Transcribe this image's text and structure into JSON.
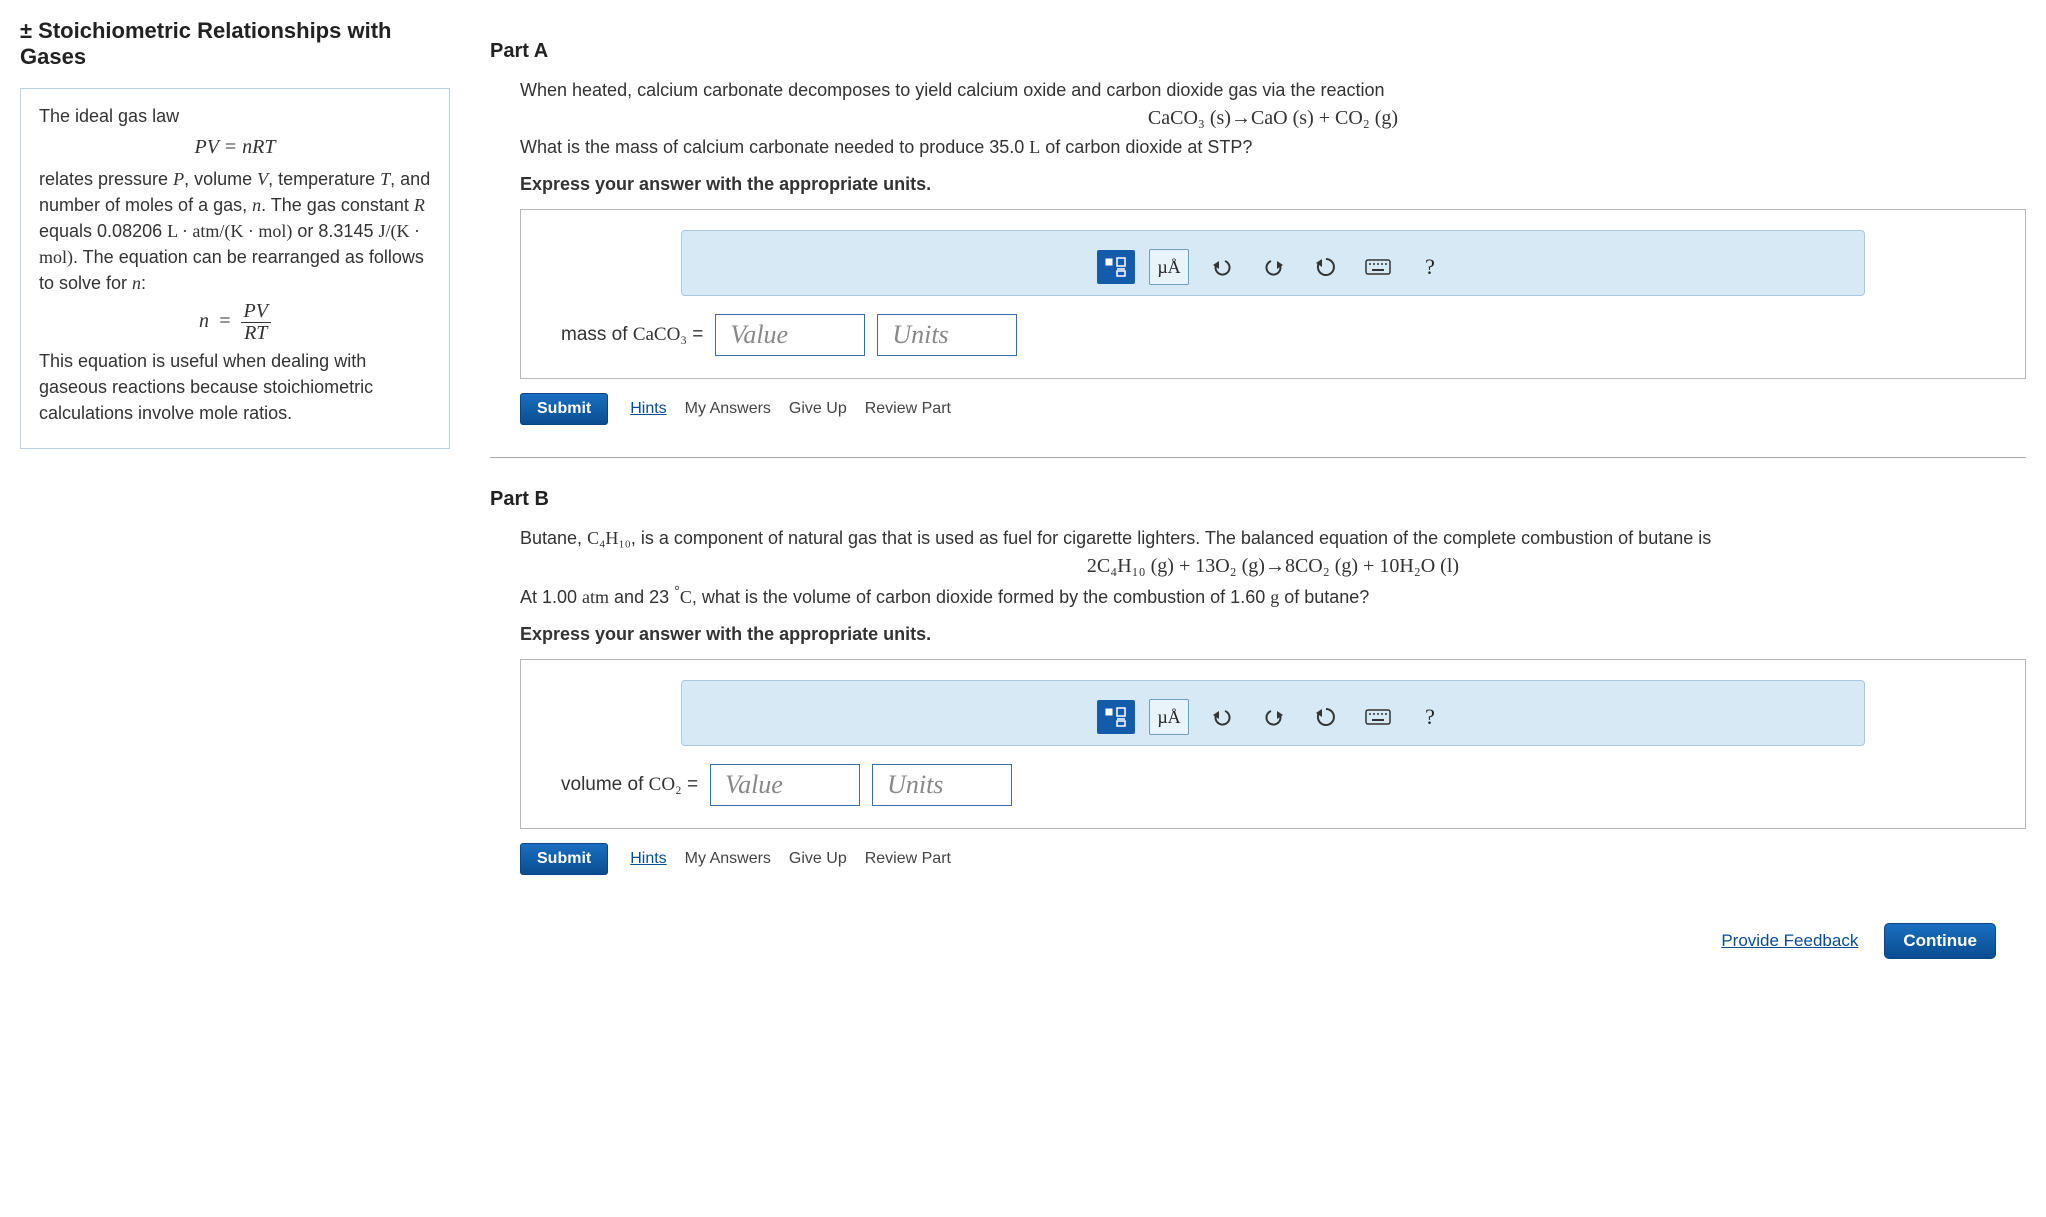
{
  "topic": {
    "title": "± Stoichiometric Relationships with Gases"
  },
  "info": {
    "line1": "The ideal gas law",
    "eq1_lhs": "PV",
    "eq1_op": "=",
    "eq1_rhs": "nRT",
    "line2_a": "relates pressure ",
    "line2_P": "P",
    "line2_b": ", volume ",
    "line2_V": "V",
    "line2_c": ", temperature ",
    "line2_T": "T",
    "line2_d": ", and number of moles of a gas, ",
    "line2_n": "n",
    "line2_e": ". The gas constant ",
    "line2_R": "R",
    "line2_f": " equals 0.08206 ",
    "unitsA": "L · atm/(K · mol)",
    "line2_g": " or 8.3145 ",
    "unitsB": "J/(K · mol)",
    "line2_h": ". The equation can be rearranged as follows to solve for ",
    "line2_n2": "n",
    "line2_i": ":",
    "eq2_lhs": "n",
    "eq2_op": "=",
    "eq2_num": "PV",
    "eq2_den": "RT",
    "line3": "This equation is useful when dealing with gaseous reactions because stoichiometric calculations involve mole ratios."
  },
  "partA": {
    "title": "Part A",
    "p1": "When heated, calcium carbonate decomposes to yield calcium oxide and carbon dioxide gas via the reaction",
    "eq": "CaCO₃ (s)→CaO (s) + CO₂ (g)",
    "p2a": "What is the mass of calcium carbonate needed to produce 35.0 ",
    "p2_unit": "L",
    "p2b": " of carbon dioxide at STP?",
    "instruct": "Express your answer with the appropriate units.",
    "lhs_a": "mass of ",
    "lhs_chem": "CaCO₃",
    "lhs_b": " =",
    "value_ph": "Value",
    "units_ph": "Units",
    "submit": "Submit",
    "hints": "Hints",
    "myans": "My Answers",
    "giveup": "Give Up",
    "review": "Review Part"
  },
  "partB": {
    "title": "Part B",
    "p1a": "Butane, ",
    "p1_chem": "C₄H₁₀",
    "p1b": ", is a component of natural gas that is used as fuel for cigarette lighters. The balanced equation of the complete combustion of butane is",
    "eq": "2C₄H₁₀ (g) + 13O₂ (g)→8CO₂ (g) + 10H₂O (l)",
    "p2a": "At 1.00 ",
    "p2_atm": "atm",
    "p2b": " and 23 ",
    "p2_deg": "°",
    "p2_C": "C",
    "p2c": ", what is the volume of carbon dioxide formed by the combustion of 1.60 ",
    "p2_g": "g",
    "p2d": " of butane?",
    "instruct": "Express your answer with the appropriate units.",
    "lhs_a": "volume of ",
    "lhs_chem": "CO₂",
    "lhs_b": " =",
    "value_ph": "Value",
    "units_ph": "Units",
    "submit": "Submit",
    "hints": "Hints",
    "myans": "My Answers",
    "giveup": "Give Up",
    "review": "Review Part"
  },
  "toolbar": {
    "units_label": "µÅ",
    "help": "?"
  },
  "footer": {
    "feedback": "Provide Feedback",
    "continue": "Continue"
  }
}
